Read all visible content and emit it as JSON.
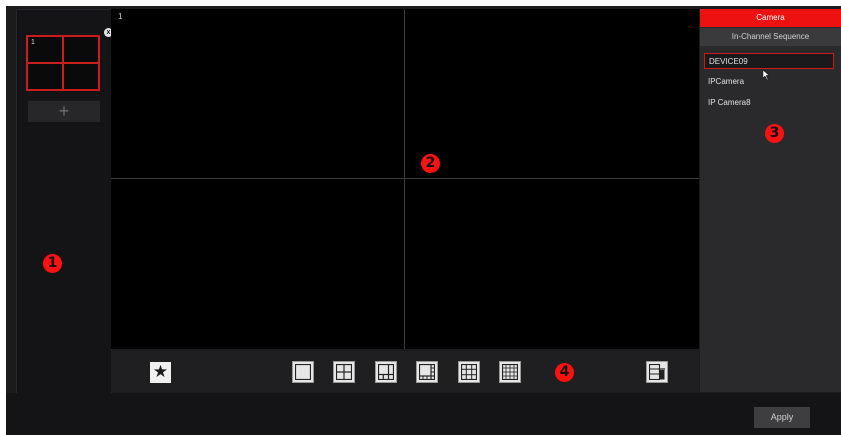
{
  "left_panel": {
    "thumbnail_channel": "1",
    "add_label": "+",
    "close_glyph": "x",
    "icons": {
      "add": "plus-icon",
      "close": "close-icon"
    }
  },
  "video_grid": {
    "channel_label": "1",
    "layout": "2x2"
  },
  "toolbar": {
    "favorite_glyph": "★",
    "layout_buttons": [
      "layout-1-icon",
      "layout-4-icon",
      "layout-6-icon",
      "layout-8-icon",
      "layout-9-icon",
      "layout-16-icon"
    ],
    "clear_icon": "delete-layout-icon"
  },
  "right_panel": {
    "tabs": [
      {
        "label": "Camera",
        "active": true
      },
      {
        "label": "In-Channel Sequence",
        "active": false
      }
    ],
    "devices": [
      "DEVICE09",
      "IPCamera",
      "IP Camera8"
    ],
    "selected_device": "DEVICE09"
  },
  "footer": {
    "apply_label": "Apply"
  },
  "markers": [
    "1",
    "2",
    "3",
    "4"
  ],
  "colors": {
    "accent": "#ee1111",
    "marker": "#ff1111",
    "background": "#1b1b1d",
    "video": "#000000"
  }
}
